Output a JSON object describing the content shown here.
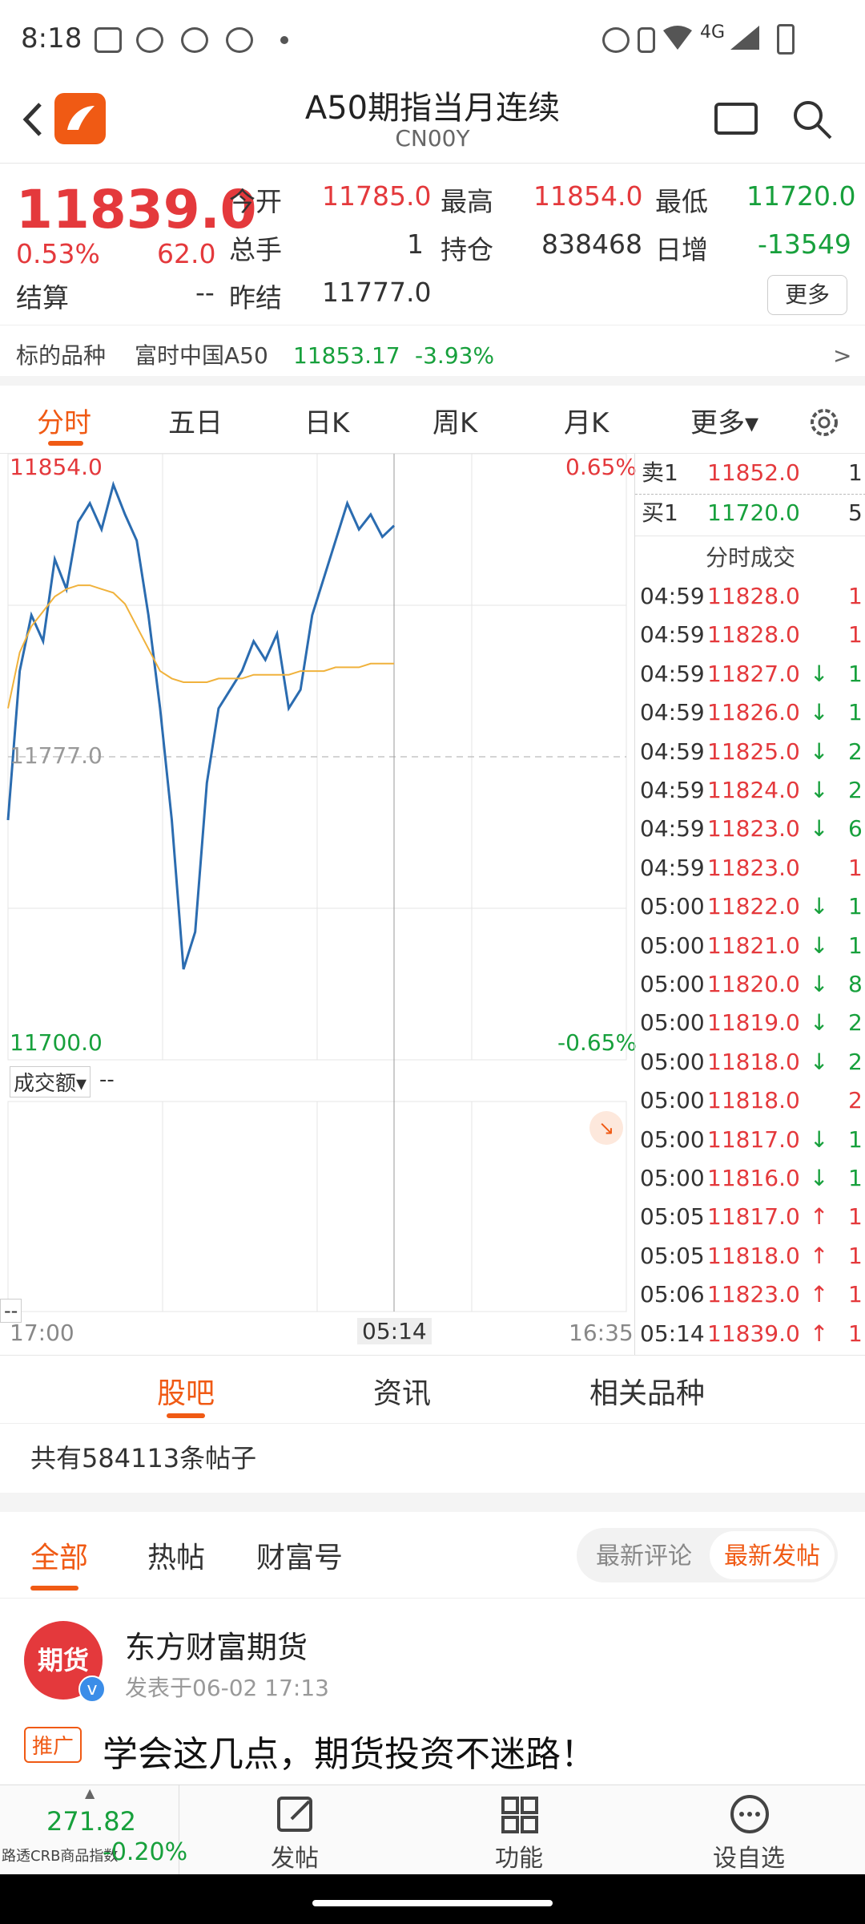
{
  "status": {
    "time": "8:18",
    "network": "4G"
  },
  "header": {
    "title": "A50期指当月连续",
    "code": "CN00Y"
  },
  "quote": {
    "last": "11839.0",
    "change_pct": "0.53%",
    "change": "62.0",
    "open_label": "今开",
    "open": "11785.0",
    "high_label": "最高",
    "high": "11854.0",
    "low_label": "最低",
    "low": "11720.0",
    "volume_label": "总手",
    "volume": "1",
    "oi_label": "持仓",
    "oi": "838468",
    "daily_inc_label": "日增",
    "daily_inc": "-13549",
    "settle_label": "结算",
    "settle": "--",
    "prev_settle_label": "昨结",
    "prev_settle": "11777.0",
    "more_label": "更多"
  },
  "underlying": {
    "label": "标的品种",
    "name": "富时中国A50",
    "price": "11853.17",
    "change_pct": "-3.93%",
    "arrow": ">"
  },
  "chart_tabs": [
    "分时",
    "五日",
    "日K",
    "周K",
    "月K",
    "更多▾"
  ],
  "chart": {
    "y_high": "11854.0",
    "y_mid": "11777.0",
    "y_low": "11700.0",
    "pct_high": "0.65%",
    "pct_low": "-0.65%",
    "volume_label": "成交额▾",
    "volume_value": "--",
    "left_value": "--",
    "x_start": "17:00",
    "x_cursor": "05:14",
    "x_end": "16:35"
  },
  "chart_data": {
    "type": "line",
    "series": [
      {
        "values": [
          11760,
          11800,
          11815,
          11808,
          11830,
          11822,
          11840,
          11845,
          11838,
          11850,
          11842,
          11835,
          11815,
          11790,
          11760,
          11720,
          11730,
          11770,
          11790,
          11795,
          11800,
          11808,
          11803,
          11810,
          11790,
          11795,
          11815,
          11825,
          11835,
          11845,
          11838,
          11842,
          11836,
          11839
        ],
        "color": "#2b6cb0"
      },
      {
        "values": [
          11790,
          11805,
          11812,
          11816,
          11820,
          11822,
          11823,
          11823,
          11822,
          11821,
          11818,
          11812,
          11806,
          11800,
          11798,
          11797,
          11797,
          11797,
          11798,
          11798,
          11798,
          11799,
          11799,
          11799,
          11799,
          11800,
          11800,
          11800,
          11801,
          11801,
          11801,
          11802,
          11802,
          11802
        ],
        "color": "#f0b23c"
      }
    ],
    "ylim": [
      11700,
      11854
    ]
  },
  "ticks": {
    "ask_label": "卖1",
    "ask_price": "11852.0",
    "ask_vol": "1",
    "bid_label": "买1",
    "bid_price": "11720.0",
    "bid_vol": "5",
    "title": "分时成交",
    "rows": [
      {
        "time": "04:59",
        "price": "11828.0",
        "dir": "",
        "vol": "1"
      },
      {
        "time": "04:59",
        "price": "11828.0",
        "dir": "",
        "vol": "1"
      },
      {
        "time": "04:59",
        "price": "11827.0",
        "dir": "↓",
        "vol": "1"
      },
      {
        "time": "04:59",
        "price": "11826.0",
        "dir": "↓",
        "vol": "1"
      },
      {
        "time": "04:59",
        "price": "11825.0",
        "dir": "↓",
        "vol": "2"
      },
      {
        "time": "04:59",
        "price": "11824.0",
        "dir": "↓",
        "vol": "2"
      },
      {
        "time": "04:59",
        "price": "11823.0",
        "dir": "↓",
        "vol": "6"
      },
      {
        "time": "04:59",
        "price": "11823.0",
        "dir": "",
        "vol": "1"
      },
      {
        "time": "05:00",
        "price": "11822.0",
        "dir": "↓",
        "vol": "1"
      },
      {
        "time": "05:00",
        "price": "11821.0",
        "dir": "↓",
        "vol": "1"
      },
      {
        "time": "05:00",
        "price": "11820.0",
        "dir": "↓",
        "vol": "8"
      },
      {
        "time": "05:00",
        "price": "11819.0",
        "dir": "↓",
        "vol": "2"
      },
      {
        "time": "05:00",
        "price": "11818.0",
        "dir": "↓",
        "vol": "2"
      },
      {
        "time": "05:00",
        "price": "11818.0",
        "dir": "",
        "vol": "2"
      },
      {
        "time": "05:00",
        "price": "11817.0",
        "dir": "↓",
        "vol": "1"
      },
      {
        "time": "05:00",
        "price": "11816.0",
        "dir": "↓",
        "vol": "1"
      },
      {
        "time": "05:05",
        "price": "11817.0",
        "dir": "↑",
        "vol": "1"
      },
      {
        "time": "05:05",
        "price": "11818.0",
        "dir": "↑",
        "vol": "1"
      },
      {
        "time": "05:06",
        "price": "11823.0",
        "dir": "↑",
        "vol": "1"
      },
      {
        "time": "05:14",
        "price": "11839.0",
        "dir": "↑",
        "vol": "1"
      }
    ]
  },
  "section_tabs": [
    "股吧",
    "资讯",
    "相关品种"
  ],
  "forum": {
    "post_count": "共有584113条帖子",
    "filters": [
      "全部",
      "热帖",
      "财富号"
    ],
    "sort_latest_comment": "最新评论",
    "sort_latest_post": "最新发帖"
  },
  "post": {
    "avatar_text": "期货",
    "author": "东方财富期货",
    "meta": "发表于06-02 17:13",
    "tag": "推广",
    "title": "学会这几点，期货投资不迷路！"
  },
  "bottom": {
    "index_value": "271.82",
    "index_name": "路透CRB商品指数",
    "index_change": "-0.20%",
    "post_label": "发帖",
    "func_label": "功能",
    "watch_label": "设自选"
  }
}
